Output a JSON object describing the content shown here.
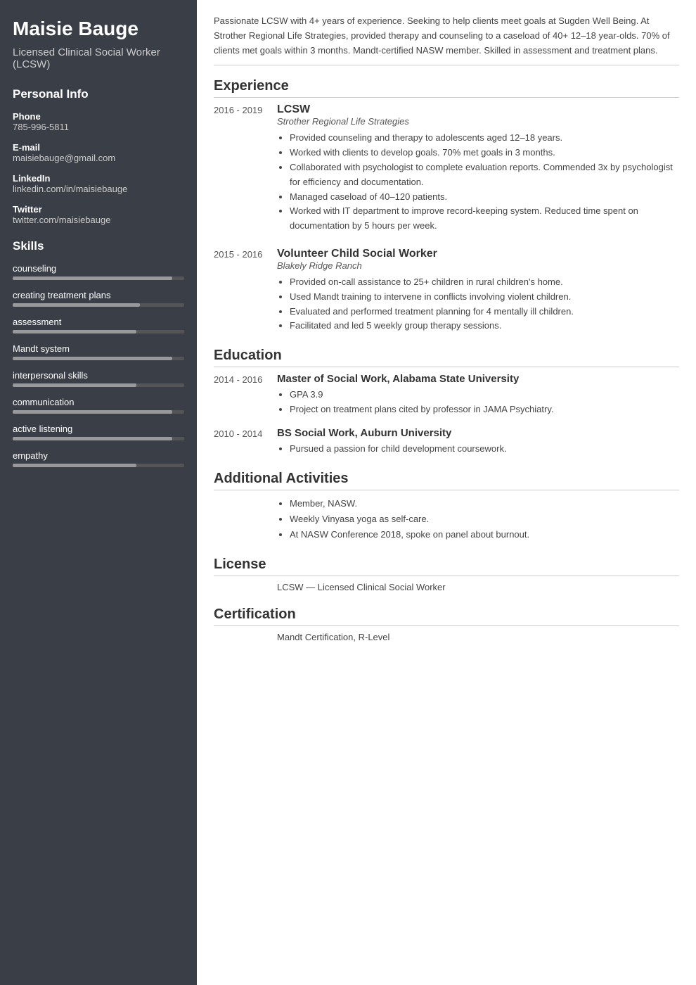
{
  "sidebar": {
    "name": "Maisie Bauge",
    "title": "Licensed Clinical Social Worker (LCSW)",
    "personalInfo": {
      "label": "Personal Info",
      "phone": {
        "label": "Phone",
        "value": "785-996-5811"
      },
      "email": {
        "label": "E-mail",
        "value": "maisiebauge@gmail.com"
      },
      "linkedin": {
        "label": "LinkedIn",
        "value": "linkedin.com/in/maisiebauge"
      },
      "twitter": {
        "label": "Twitter",
        "value": "twitter.com/maisiebauge"
      }
    },
    "skills": {
      "label": "Skills",
      "items": [
        {
          "name": "counseling",
          "fill": 93,
          "total": 100
        },
        {
          "name": "creating treatment plans",
          "fill": 74,
          "total": 100
        },
        {
          "name": "assessment",
          "fill": 72,
          "total": 100
        },
        {
          "name": "Mandt system",
          "fill": 93,
          "total": 100
        },
        {
          "name": "interpersonal skills",
          "fill": 72,
          "total": 100
        },
        {
          "name": "communication",
          "fill": 93,
          "total": 100
        },
        {
          "name": "active listening",
          "fill": 93,
          "total": 100
        },
        {
          "name": "empathy",
          "fill": 72,
          "total": 100
        }
      ]
    }
  },
  "main": {
    "summary": "Passionate LCSW with 4+ years of experience. Seeking to help clients meet goals at Sugden Well Being. At Strother Regional Life Strategies, provided therapy and counseling to a caseload of 40+ 12–18 year-olds. 70% of clients met goals within 3 months. Mandt-certified NASW member. Skilled in assessment and treatment plans.",
    "experience": {
      "label": "Experience",
      "entries": [
        {
          "dates": "2016 - 2019",
          "title": "LCSW",
          "company": "Strother Regional Life Strategies",
          "bullets": [
            "Provided counseling and therapy to adolescents aged 12–18 years.",
            "Worked with clients to develop goals. 70% met goals in 3 months.",
            "Collaborated with psychologist to complete evaluation reports. Commended 3x by psychologist for efficiency and documentation.",
            "Managed caseload of 40–120 patients.",
            "Worked with IT department to improve record-keeping system. Reduced time spent on documentation by 5 hours per week."
          ]
        },
        {
          "dates": "2015 - 2016",
          "title": "Volunteer Child Social Worker",
          "company": "Blakely Ridge Ranch",
          "bullets": [
            "Provided on-call assistance to 25+ children in rural children's home.",
            "Used Mandt training to intervene in conflicts involving violent children.",
            "Evaluated and performed treatment planning for 4 mentally ill children.",
            "Facilitated and led 5 weekly group therapy sessions."
          ]
        }
      ]
    },
    "education": {
      "label": "Education",
      "entries": [
        {
          "dates": "2014 - 2016",
          "degree": "Master of Social Work, Alabama State University",
          "bullets": [
            "GPA 3.9",
            "Project on treatment plans cited by professor in JAMA Psychiatry."
          ]
        },
        {
          "dates": "2010 - 2014",
          "degree": "BS Social Work, Auburn University",
          "bullets": [
            "Pursued a passion for child development coursework."
          ]
        }
      ]
    },
    "additionalActivities": {
      "label": "Additional Activities",
      "bullets": [
        "Member, NASW.",
        "Weekly Vinyasa yoga as self-care.",
        "At NASW Conference 2018, spoke on panel about burnout."
      ]
    },
    "license": {
      "label": "License",
      "value": "LCSW — Licensed Clinical Social Worker"
    },
    "certification": {
      "label": "Certification",
      "value": "Mandt Certification, R-Level"
    }
  }
}
